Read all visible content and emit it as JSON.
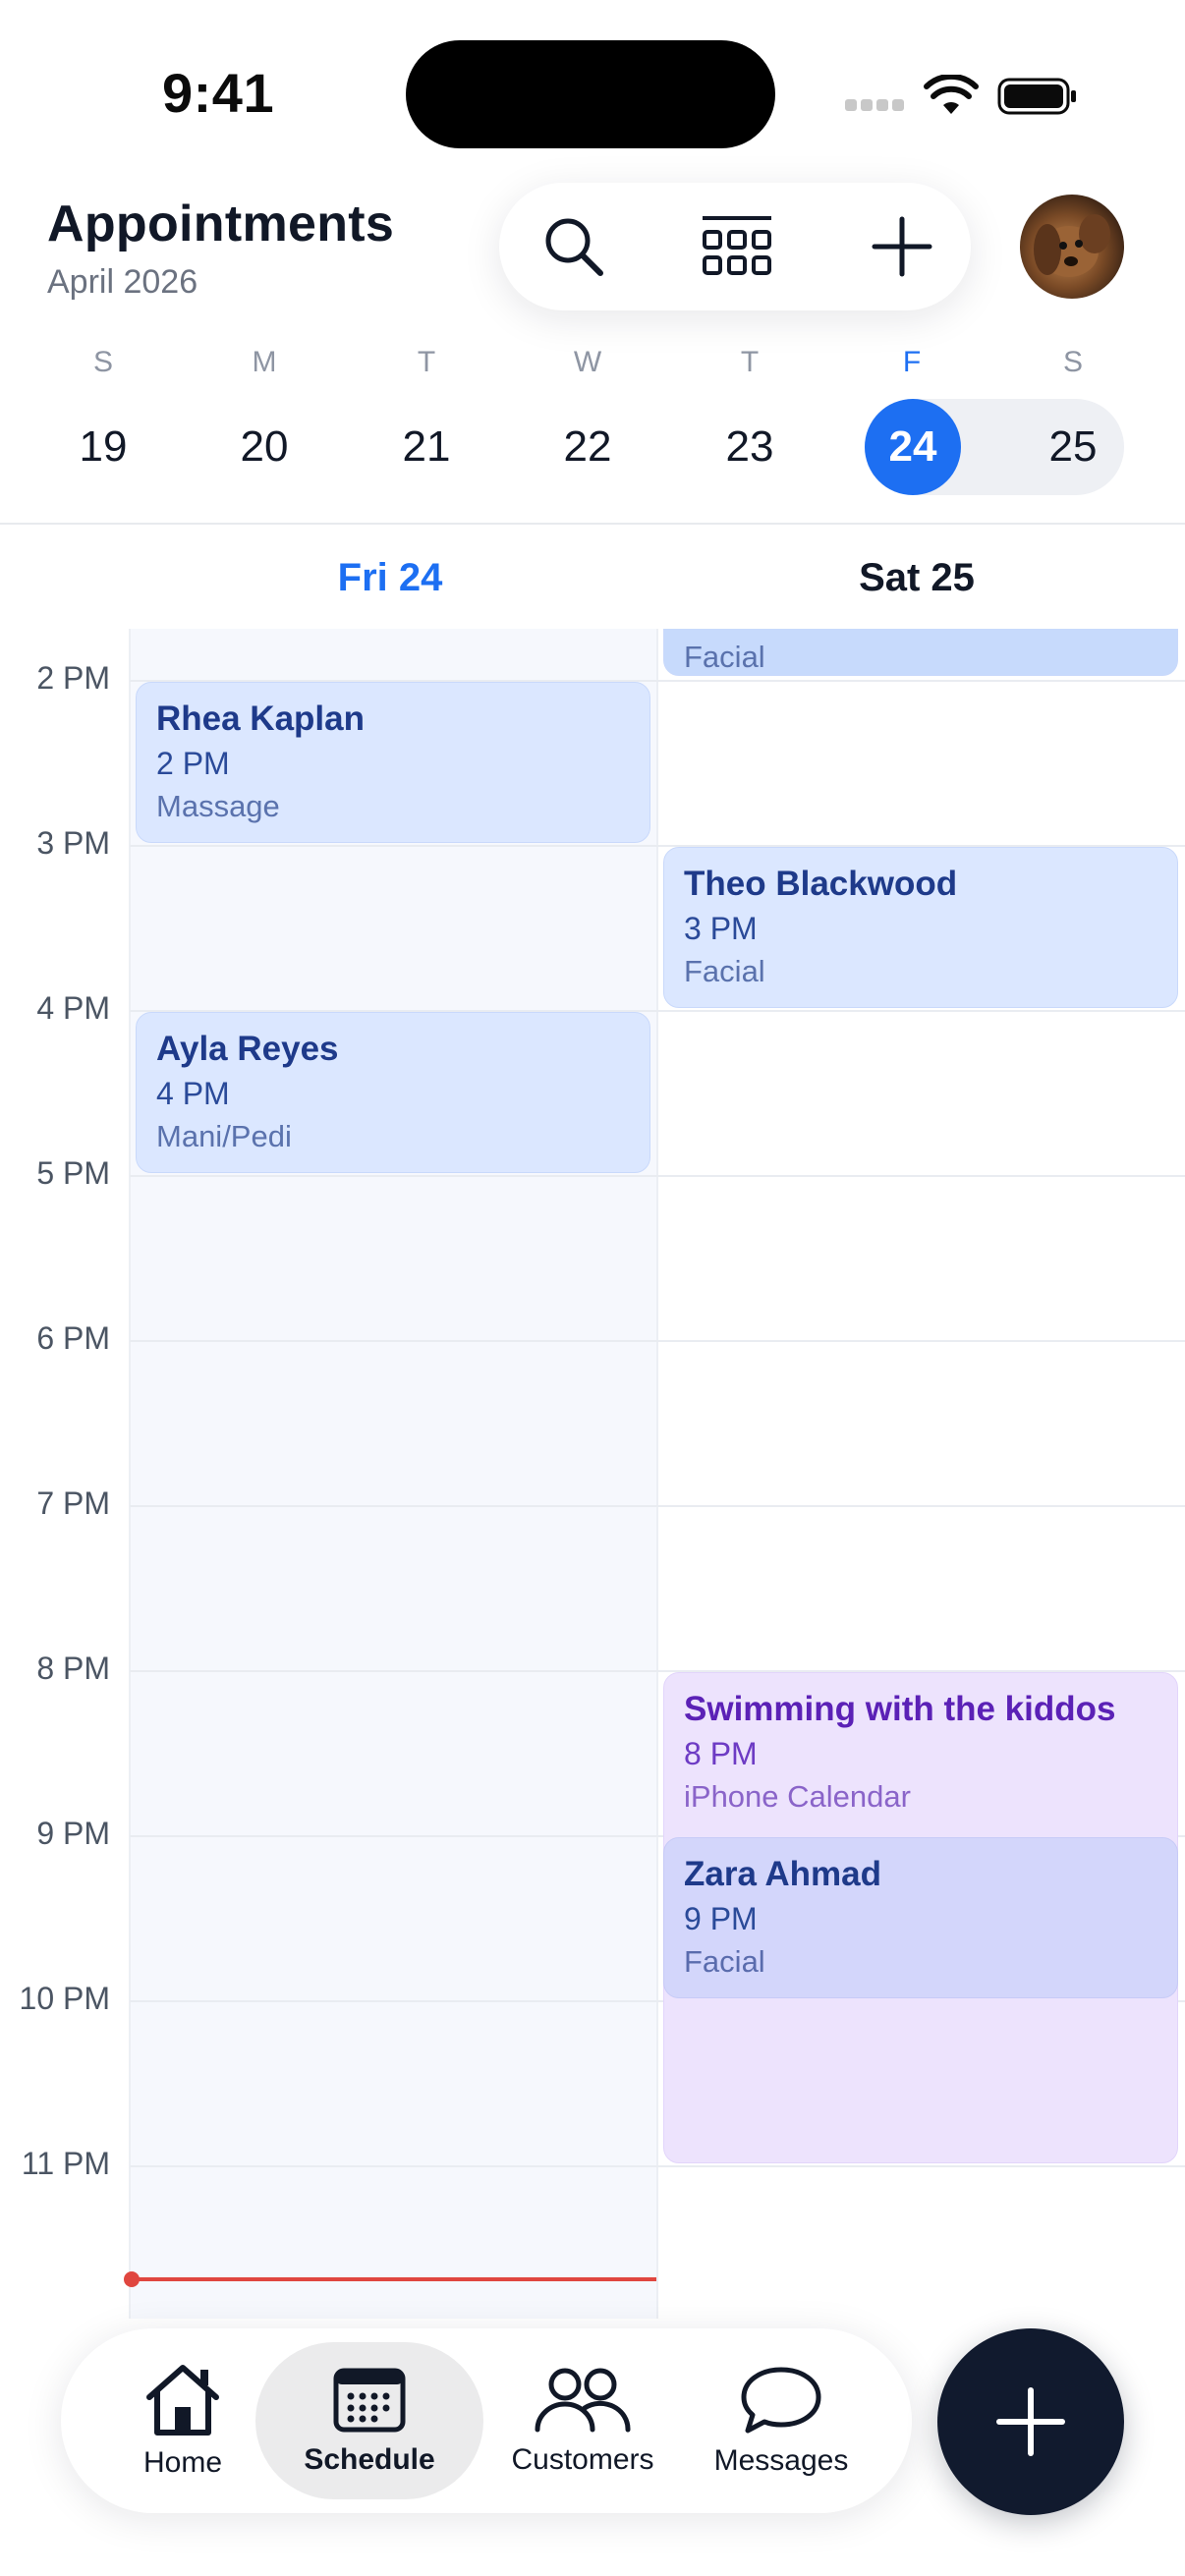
{
  "status_bar": {
    "time": "9:41"
  },
  "header": {
    "title": "Appointments",
    "subtitle": "April 2026"
  },
  "toolbar": {
    "icons": [
      "search-icon",
      "grid-view-icon",
      "plus-icon"
    ]
  },
  "week": {
    "letters": [
      "S",
      "M",
      "T",
      "W",
      "T",
      "F",
      "S"
    ],
    "numbers": [
      "19",
      "20",
      "21",
      "22",
      "23",
      "24",
      "25"
    ],
    "selected_index": 5
  },
  "columns": {
    "fri": "Fri 24",
    "sat": "Sat 25"
  },
  "hours": [
    "2 PM",
    "3 PM",
    "4 PM",
    "5 PM",
    "6 PM",
    "7 PM",
    "8 PM",
    "9 PM",
    "10 PM",
    "11 PM"
  ],
  "events": {
    "sat_top": {
      "sub": "Facial"
    },
    "rhea": {
      "name": "Rhea Kaplan",
      "time": "2 PM",
      "sub": "Massage"
    },
    "ayla": {
      "name": "Ayla Reyes",
      "time": "4 PM",
      "sub": "Mani/Pedi"
    },
    "theo": {
      "name": "Theo Blackwood",
      "time": "3 PM",
      "sub": "Facial"
    },
    "swim": {
      "name": "Swimming with the kiddos",
      "time": "8 PM",
      "sub": "iPhone Calendar"
    },
    "zara": {
      "name": "Zara Ahmad",
      "time": "9 PM",
      "sub": "Facial"
    }
  },
  "tabs": [
    {
      "label": "Home",
      "icon": "home-icon"
    },
    {
      "label": "Schedule",
      "icon": "calendar-icon",
      "active": true
    },
    {
      "label": "Customers",
      "icon": "people-icon"
    },
    {
      "label": "Messages",
      "icon": "message-icon"
    }
  ],
  "colors": {
    "accent": "#1d6ff2",
    "now_line": "#e0463f",
    "fab": "#111a2e"
  }
}
